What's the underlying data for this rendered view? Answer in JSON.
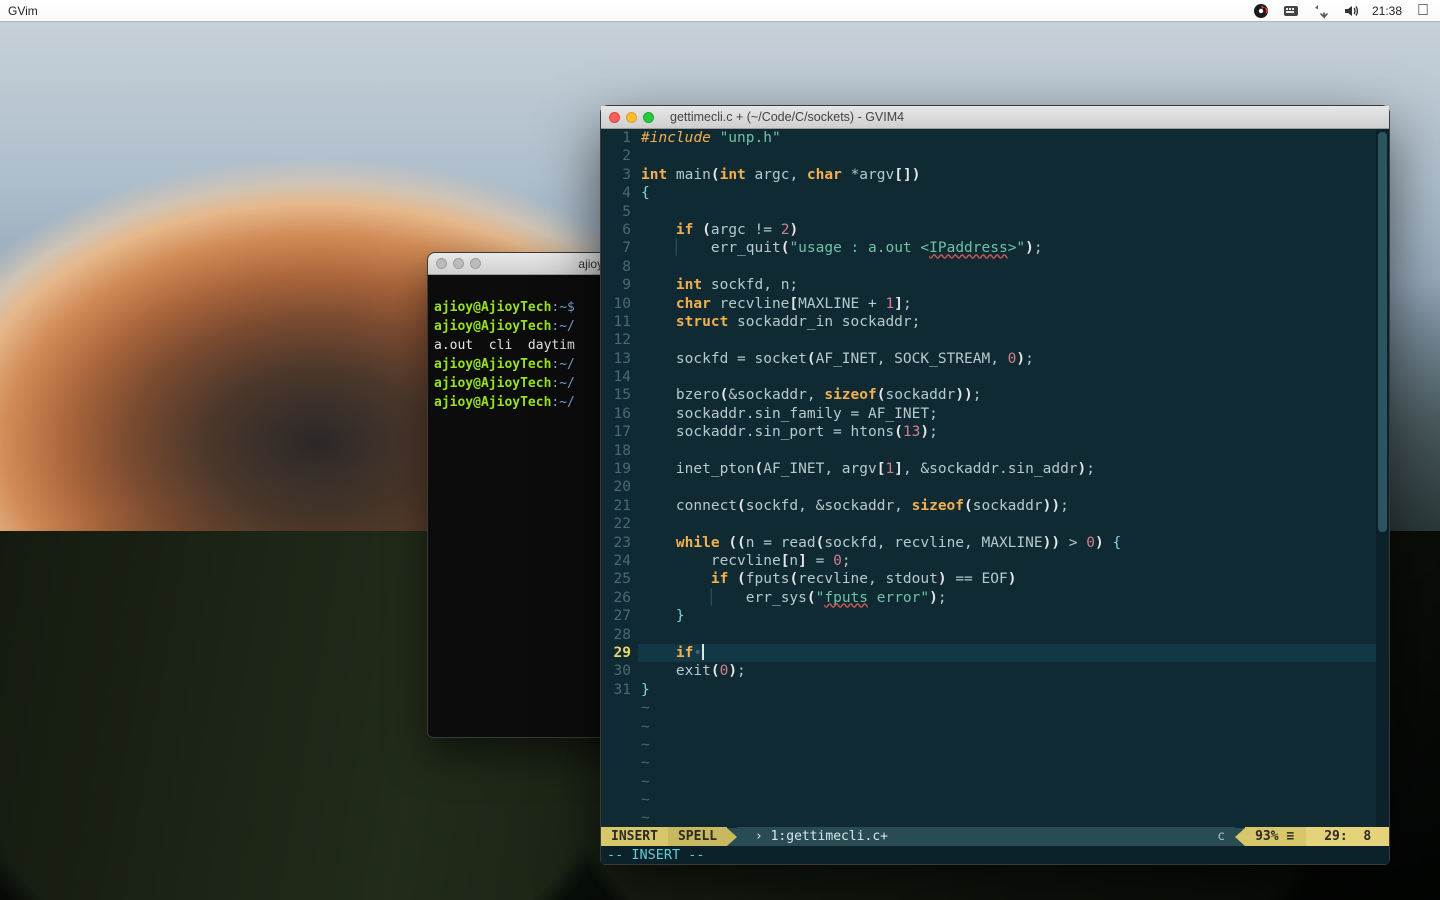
{
  "menubar": {
    "app_name": "GVim",
    "clock": "21:38",
    "icons": [
      "obs-icon",
      "keyboard-icon",
      "updown-icon",
      "volume-icon",
      "apple-menu-icon"
    ]
  },
  "terminal": {
    "title": "ajioy@AjioyT",
    "lines": [
      {
        "prompt": "ajioy@AjioyTech",
        "path": ":~$",
        "rest": ""
      },
      {
        "prompt": "ajioy@AjioyTech",
        "path": ":~/",
        "rest": ""
      },
      {
        "plain": "a.out  cli  daytim"
      },
      {
        "prompt": "ajioy@AjioyTech",
        "path": ":~/",
        "rest": ""
      },
      {
        "prompt": "ajioy@AjioyTech",
        "path": ":~/",
        "rest": ""
      },
      {
        "prompt": "ajioy@AjioyTech",
        "path": ":~/",
        "rest": ""
      }
    ]
  },
  "gvim": {
    "title": "gettimecli.c + (~/Code/C/sockets) - GVIM4",
    "current_line": 29,
    "lines": {
      "l1": {
        "pp": "#include",
        "sp": " ",
        "str": "\"unp.h\""
      },
      "l3": {
        "kw1": "int",
        "fn": " main",
        "p1": "(",
        "kw2": "int",
        "a1": " argc",
        "c1": ",",
        "sp": " ",
        "kw3": "char",
        "a2": " *argv",
        "br1": "[",
        "br2": "]",
        "p2": ")"
      },
      "l4": {
        "brace": "{"
      },
      "l6": {
        "kw": "if",
        "sp": " ",
        "p1": "(",
        "v": "argc != ",
        "num": "2",
        "p2": ")"
      },
      "l7": {
        "fn": "err_quit",
        "p1": "(",
        "s1": "\"usage : a.out <",
        "err": "IPaddress",
        "s2": ">\"",
        "p2": ")",
        ";": ";"
      },
      "l9": {
        "kw": "int",
        "v": " sockfd",
        "c": ",",
        "v2": " n",
        ";": ";"
      },
      "l10": {
        "kw": "char",
        "v": " recvline",
        "b1": "[",
        "mc": "MAXLINE + ",
        "num": "1",
        "b2": "]",
        ";": ";"
      },
      "l11": {
        "kw": "struct",
        "v": " sockaddr_in sockaddr",
        ";": ";"
      },
      "l13": {
        "v": "sockfd = socket",
        "p1": "(",
        "a": "AF_INET",
        "c1": ",",
        "sp1": " ",
        "a2": "SOCK_STREAM",
        "c2": ",",
        "sp2": " ",
        "num": "0",
        "p2": ")",
        ";": ";"
      },
      "l15": {
        "v": "bzero",
        "p1": "(",
        "a": "&sockaddr",
        "c": ",",
        "sp": " ",
        "kw": "sizeof",
        "p2": "(",
        "a2": "sockaddr",
        "p3": ")",
        "p4": ")",
        ";": ";"
      },
      "l16": {
        "v": "sockaddr.sin_family = AF_INET",
        ";": ";"
      },
      "l17": {
        "v": "sockaddr.sin_port = htons",
        "p1": "(",
        "num": "13",
        "p2": ")",
        ";": ";"
      },
      "l19": {
        "v": "inet_pton",
        "p1": "(",
        "a": "AF_INET",
        "c1": ",",
        "sp1": " ",
        "a2": "argv",
        "b1": "[",
        "num": "1",
        "b2": "]",
        "c2": ",",
        "sp2": " ",
        "a3": "&sockaddr.sin_addr",
        "p2": ")",
        ";": ";"
      },
      "l21": {
        "v": "connect",
        "p1": "(",
        "a": "sockfd",
        "c1": ",",
        "sp1": " ",
        "a2": "&sockaddr",
        "c2": ",",
        "sp2": " ",
        "kw": "sizeof",
        "p2": "(",
        "a3": "sockaddr",
        "p3": ")",
        "p4": ")",
        ";": ";"
      },
      "l23": {
        "kw": "while",
        "sp": " ",
        "p1": "(",
        "p2": "(",
        "v": "n = read",
        "p3": "(",
        "a": "sockfd",
        "c1": ",",
        "sp1": " ",
        "a2": "recvline",
        "c2": ",",
        "sp2": " ",
        "a3": "MAXLINE",
        "p4": ")",
        "p5": ")",
        "gt": " > ",
        "num": "0",
        "p6": ")",
        "sp3": " ",
        "br": "{"
      },
      "l24": {
        "v": "recvline",
        "b1": "[",
        "a": "n",
        "b2": "]",
        "eq": " = ",
        "num": "0",
        ";": ";"
      },
      "l25": {
        "kw": "if",
        "sp": " ",
        "p1": "(",
        "v": "fputs",
        "p2": "(",
        "a": "recvline",
        "c1": ",",
        "sp1": " ",
        "a2": "stdout",
        "p3": ")",
        "eq": " == ",
        "eof": "EOF",
        "p4": ")"
      },
      "l26": {
        "v": "err_sys",
        "p1": "(",
        "s1": "\"",
        "err": "fputs",
        "s2": " error\"",
        "p2": ")",
        ";": ";"
      },
      "l27": {
        "br": "}"
      },
      "l29": {
        "kw": "if",
        "dot": "•"
      },
      "l30": {
        "v": "exit",
        "p1": "(",
        "num": "0",
        "p2": ")",
        ";": ";"
      },
      "l31": {
        "brace": "}"
      }
    },
    "status": {
      "mode": "INSERT",
      "spell": "SPELL",
      "buffer": "1:gettimecli.c+",
      "filetype": "c",
      "percent": "93%",
      "line": "29:",
      "col": "8"
    },
    "cmdline": "-- INSERT --"
  }
}
